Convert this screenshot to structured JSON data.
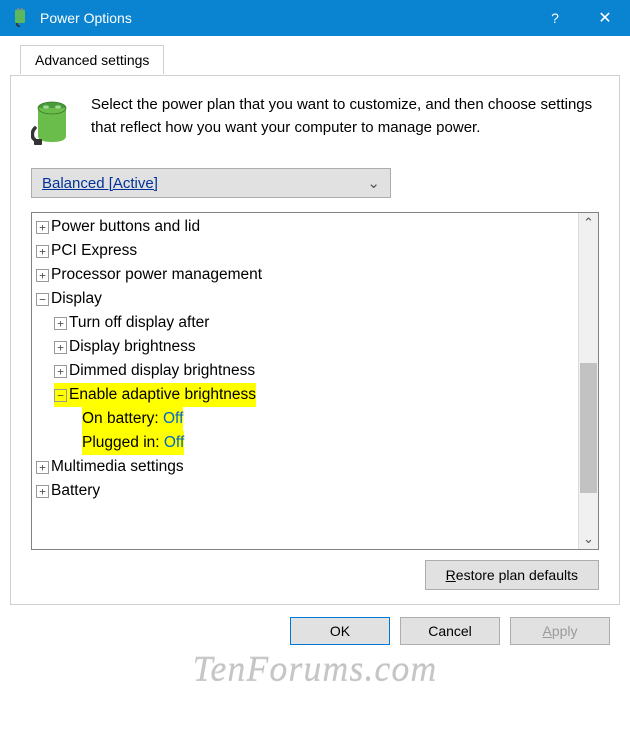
{
  "titlebar": {
    "title": "Power Options"
  },
  "tab": {
    "label": "Advanced settings"
  },
  "intro": "Select the power plan that you want to customize, and then choose settings that reflect how you want your computer to manage power.",
  "plan_selected": "Balanced [Active]",
  "tree": {
    "power_buttons": "Power buttons and lid",
    "pci": "PCI Express",
    "processor": "Processor power management",
    "display": "Display",
    "turn_off": "Turn off display after",
    "brightness": "Display brightness",
    "dimmed": "Dimmed display brightness",
    "adaptive": "Enable adaptive brightness",
    "on_battery_label": "On battery: ",
    "on_battery_val": "Off",
    "plugged_label": "Plugged in: ",
    "plugged_val": "Off",
    "multimedia": "Multimedia settings",
    "battery_node": "Battery"
  },
  "buttons": {
    "restore_prefix": "R",
    "restore_rest": "estore plan defaults",
    "ok": "OK",
    "cancel": "Cancel",
    "apply_prefix": "A",
    "apply_rest": "pply"
  },
  "watermark": "TenForums.com"
}
